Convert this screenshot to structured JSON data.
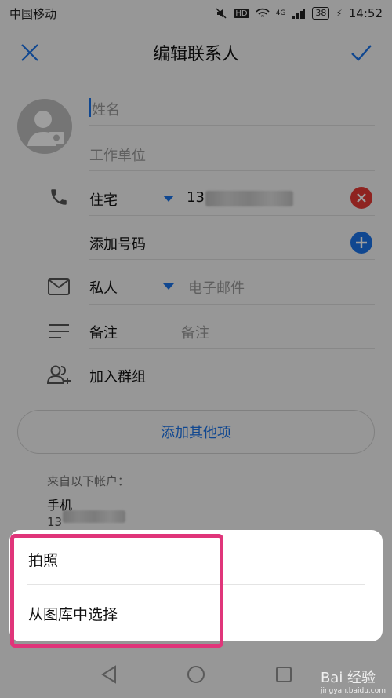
{
  "status_bar": {
    "carrier": "中国移动",
    "battery": "38",
    "time": "14:52",
    "network": "4G"
  },
  "header": {
    "title": "编辑联系人"
  },
  "form": {
    "name_placeholder": "姓名",
    "company_placeholder": "工作单位",
    "phone_type": "住宅",
    "phone_value": "13",
    "add_phone_label": "添加号码",
    "email_type": "私人",
    "email_placeholder": "电子邮件",
    "note_label": "备注",
    "note_placeholder": "备注",
    "group_label": "加入群组",
    "add_more_label": "添加其他项"
  },
  "account": {
    "from_label": "来自以下帐户：",
    "account_name": "手机",
    "account_number": "13"
  },
  "bottom_sheet": {
    "items": [
      "拍照",
      "从图库中选择"
    ]
  },
  "watermark": {
    "text": "Bai 经验",
    "url": "jingyan.baidu.com"
  },
  "colors": {
    "accent": "#1a73e8",
    "delete": "#e53935",
    "highlight": "#e0357a"
  }
}
